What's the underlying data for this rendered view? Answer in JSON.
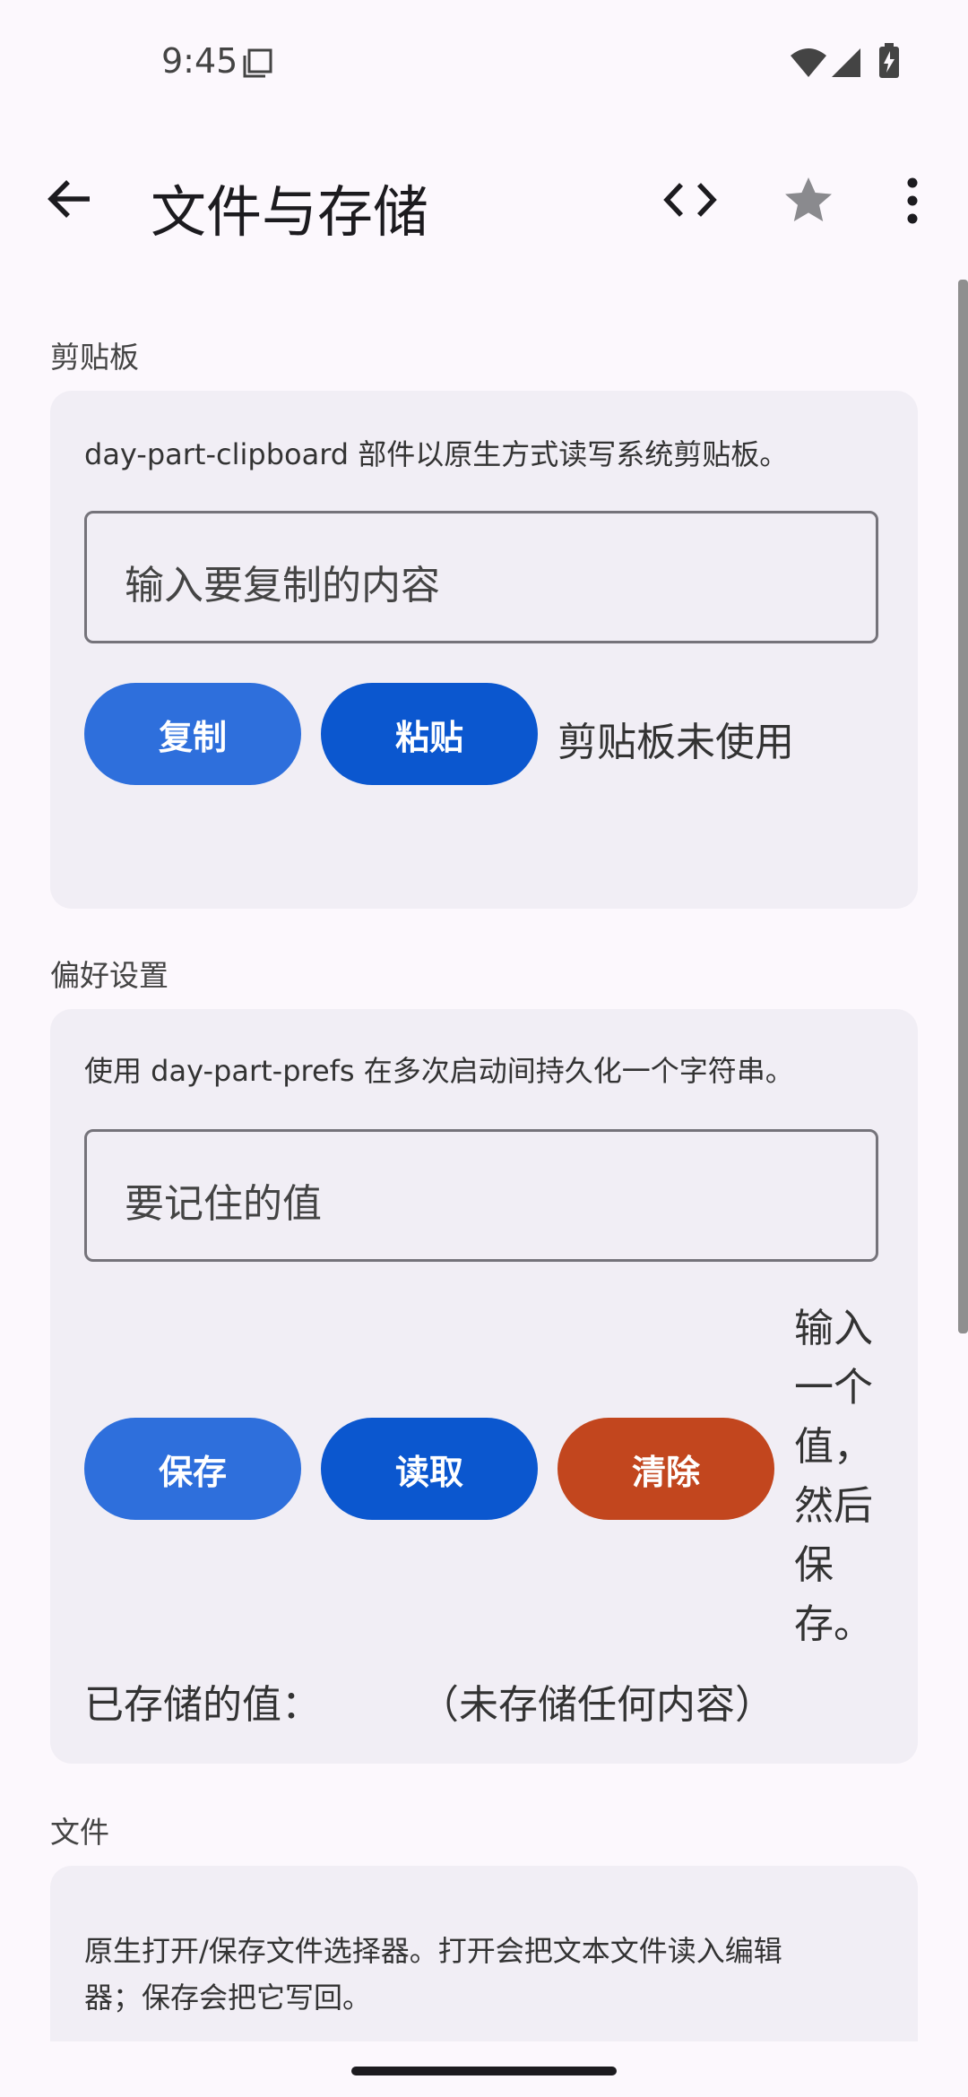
{
  "status_bar": {
    "time": "9:45"
  },
  "app_bar": {
    "title": "文件与存储"
  },
  "clipboard": {
    "heading": "剪贴板",
    "description": "day-part-clipboard 部件以原生方式读写系统剪贴板。",
    "input_placeholder": "输入要复制的内容",
    "copy_label": "复制",
    "paste_label": "粘贴",
    "status": "剪贴板未使用"
  },
  "prefs": {
    "heading": "偏好设置",
    "description": "使用 day-part-prefs 在多次启动间持久化一个字符串。",
    "input_placeholder": "要记住的值",
    "save_label": "保存",
    "read_label": "读取",
    "clear_label": "清除",
    "hint_lines": [
      "输入",
      "一个",
      "值，",
      "然后",
      "保",
      "存。"
    ],
    "stored_label": "已存储的值：",
    "stored_value": "（未存储任何内容）"
  },
  "files": {
    "heading": "文件",
    "description_line1": "原生打开/保存文件选择器。打开会把文本文件读入编辑",
    "description_line2": "器；保存会把它写回。"
  },
  "colors": {
    "button_primary": "#2e6fdc",
    "button_dark": "#0b57cf",
    "button_danger": "#c2461e",
    "card_bg": "#f1eef5"
  }
}
